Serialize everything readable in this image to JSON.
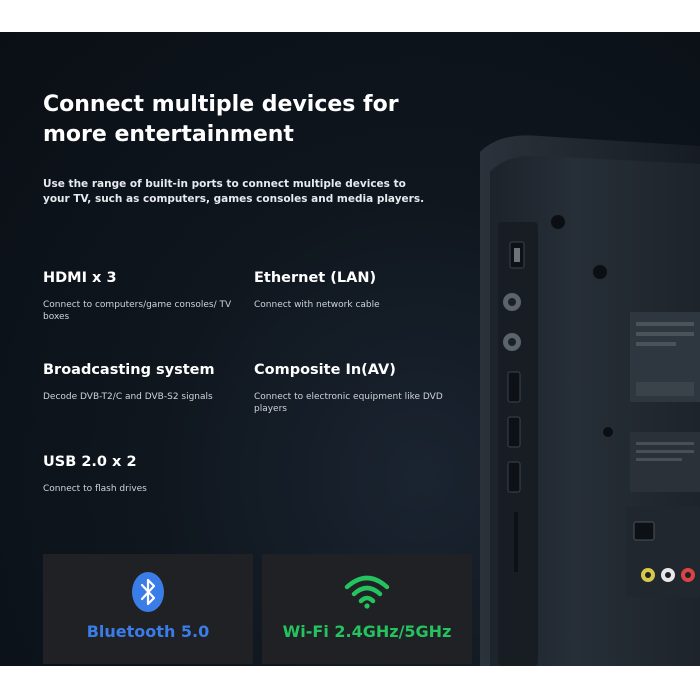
{
  "headline": "Connect multiple devices for more entertainment",
  "intro": "Use the range of built-in ports to connect multiple devices to your TV, such as computers, games consoles and media players.",
  "features": [
    {
      "title": "HDMI x 3",
      "desc": "Connect to computers/game consoles/ TV boxes"
    },
    {
      "title": "Ethernet (LAN)",
      "desc": "Connect with network cable"
    },
    {
      "title": "Broadcasting system",
      "desc": "Decode DVB-T2/C and DVB-S2 signals"
    },
    {
      "title": "Composite In(AV)",
      "desc": "Connect to electronic equipment like DVD players"
    },
    {
      "title": "USB 2.0 x 2",
      "desc": "Connect to flash drives"
    }
  ],
  "cards": [
    {
      "label": "Bluetooth 5.0",
      "icon": "bluetooth-icon",
      "color": "#3a7de8"
    },
    {
      "label": "Wi-Fi 2.4GHz/5GHz",
      "icon": "wifi-icon",
      "color": "#25c35f"
    }
  ]
}
